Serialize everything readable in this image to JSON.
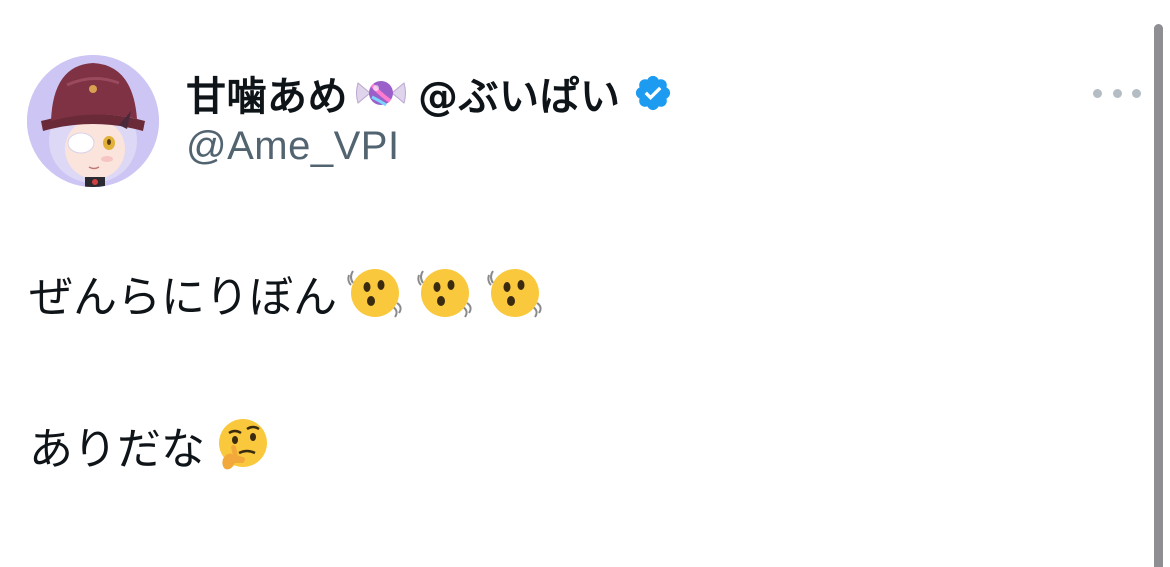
{
  "tweet": {
    "author": {
      "display_name_part1": "甘噛あめ",
      "display_name_part2": "@ぶいぱい",
      "name_emoji": "candy-icon",
      "verified": true,
      "handle": "@Ame_VPI"
    },
    "body": {
      "line1": "ぜんらにりぼん",
      "line1_emojis": [
        "shaking-face-emoji",
        "shaking-face-emoji",
        "shaking-face-emoji"
      ],
      "line2": "ありだな",
      "line2_emojis": [
        "thinking-face-emoji"
      ]
    },
    "more_menu_icon": "more-dots-icon"
  },
  "colors": {
    "name_text": "#0f1419",
    "handle_text": "#536471",
    "verified_badge": "#1d9bf0",
    "more_dots": "#b4bcc4",
    "background": "#ffffff",
    "scrollbar": "#8e8e93"
  }
}
